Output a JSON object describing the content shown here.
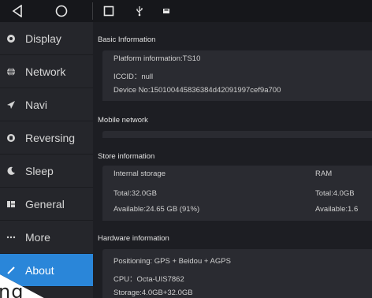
{
  "statusbar": {
    "icons": [
      "back-triangle",
      "home-circle",
      "recent-square",
      "usb",
      "image"
    ]
  },
  "sidebar": {
    "items": [
      {
        "label": "Display",
        "icon": "display-icon"
      },
      {
        "label": "Network",
        "icon": "globe-icon"
      },
      {
        "label": "Navi",
        "icon": "navigation-arrow-icon"
      },
      {
        "label": "Reversing",
        "icon": "camera-icon"
      },
      {
        "label": "Sleep",
        "icon": "moon-icon"
      },
      {
        "label": "General",
        "icon": "general-grid-icon"
      },
      {
        "label": "More",
        "icon": "more-dots-icon"
      },
      {
        "label": "About",
        "icon": "about-icon",
        "active": true
      }
    ]
  },
  "basic": {
    "heading": "Basic Information",
    "platform": "Platform information:TS10",
    "iccid": "ICCID：null",
    "device": "Device No:150100445836384d42091997cef9a700"
  },
  "mobile": {
    "heading": "Mobile network"
  },
  "store": {
    "heading": "Store information",
    "internal_label": "Internal storage",
    "ram_label": "RAM",
    "internal_total": "Total:32.0GB",
    "internal_available": "Available:24.65 GB (91%)",
    "ram_total": "Total:4.0GB",
    "ram_available": "Available:1.6"
  },
  "hardware": {
    "heading": "Hardware information",
    "positioning": "Positioning: GPS + Beidou + AGPS",
    "cpu": "CPU：Octa-UIS7862",
    "storage": "Storage:4.0GB+32.0GB"
  },
  "overlay": {
    "text": "ng"
  },
  "colors": {
    "accent": "#2a86d9",
    "sidebar_bg": "#25262b",
    "content_bg": "#1d1e23",
    "card_bg": "#2a2b31"
  }
}
